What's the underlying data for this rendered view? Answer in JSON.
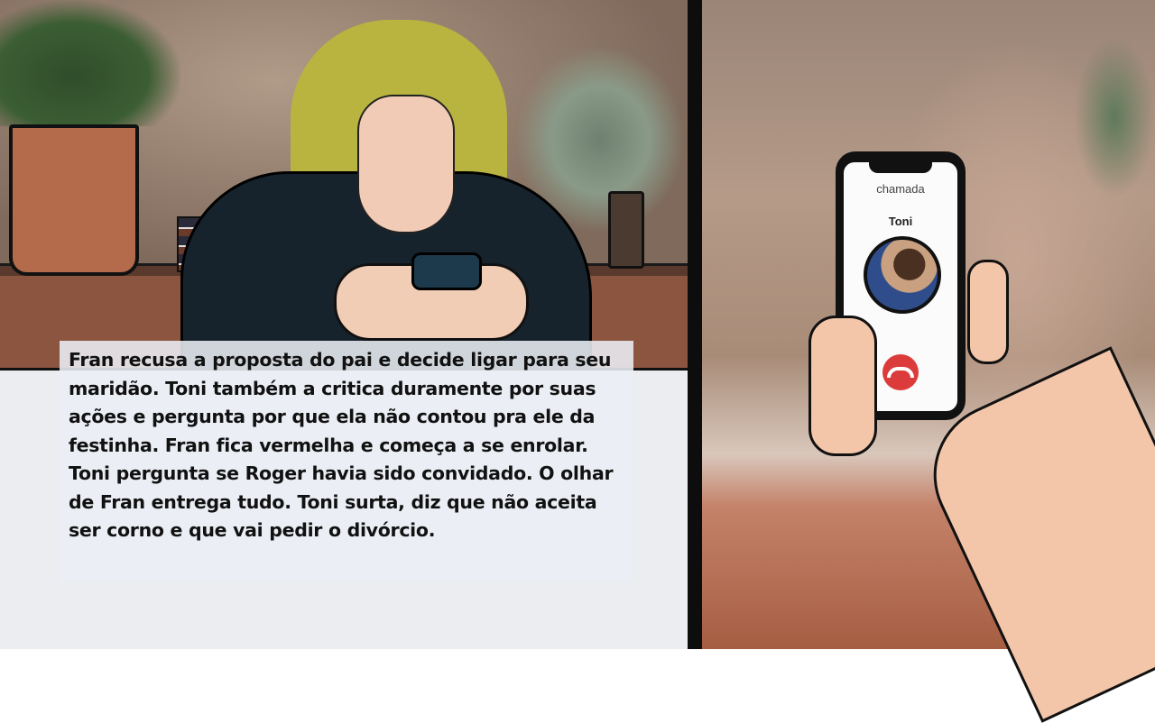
{
  "caption": {
    "text": "Fran recusa a proposta do pai e decide ligar para seu maridão. Toni também a critica duramente por suas ações e pergunta por que ela não contou pra ele da festinha. Fran fica vermelha e começa a se enrolar. Toni pergunta se Roger havia sido convidado. O olhar de Fran entrega tudo. Toni surta, diz que não aceita ser corno e que vai pedir o divórcio."
  },
  "phone": {
    "call_label": "chamada",
    "caller_name": "Toni",
    "hangup_icon": "phone-hangup-icon",
    "hangup_color": "#dc3b3b"
  }
}
